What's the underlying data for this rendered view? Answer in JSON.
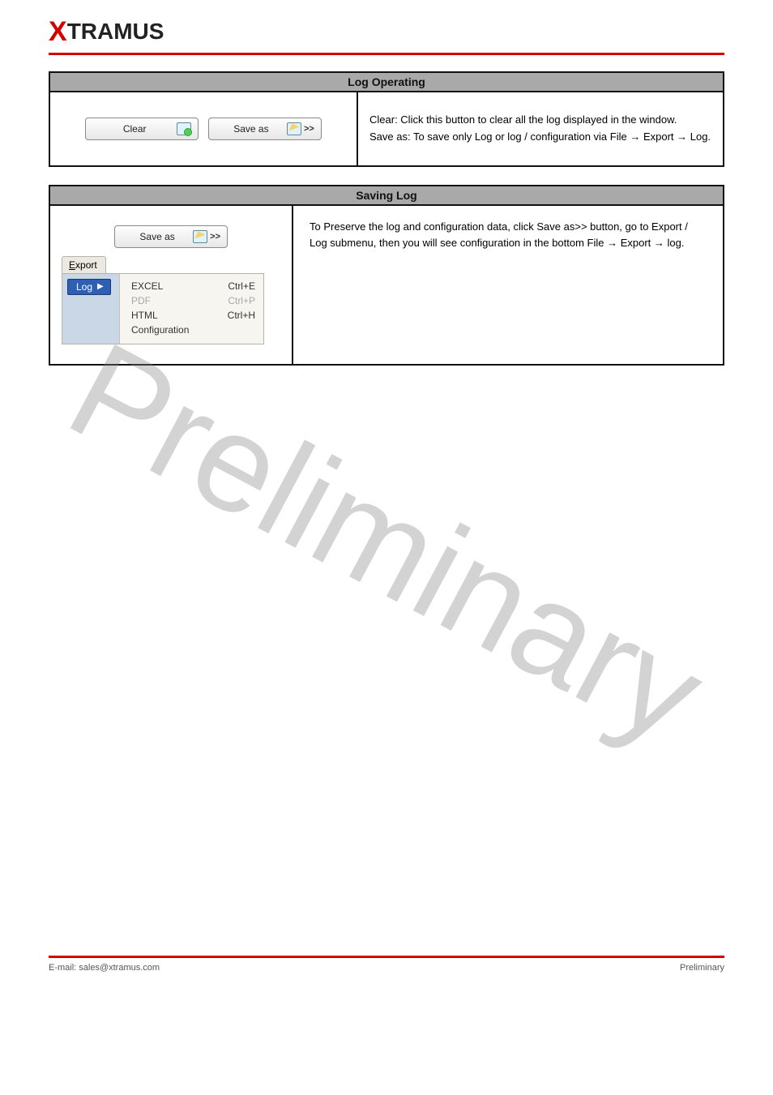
{
  "brand": {
    "x": "X",
    "rest": "TRAMUS"
  },
  "watermark": "Preliminary",
  "footer": {
    "left": "E-mail: sales@xtramus.com",
    "right": "Preliminary"
  },
  "table1": {
    "title": "Log Operating",
    "buttons": {
      "clear": "Clear",
      "saveas": "Save as",
      "chev": ">>"
    },
    "right_lines": [
      "Clear: Click this button to clear all the log displayed in the window.",
      "Save as: To save only Log or log / configuration via File → Export → Log."
    ]
  },
  "table2": {
    "title": "Saving Log",
    "button": {
      "saveas": "Save as",
      "chev": ">>"
    },
    "export_label_pre": "E",
    "export_label_post": "xport",
    "log_label": "Log",
    "items": [
      {
        "label": "EXCEL",
        "sc": "Ctrl+E",
        "disabled": false
      },
      {
        "label": "PDF",
        "sc": "Ctrl+P",
        "disabled": true
      },
      {
        "label": "HTML",
        "sc": "Ctrl+H",
        "disabled": false
      },
      {
        "label": "Configuration",
        "sc": "",
        "disabled": false
      }
    ],
    "right_lines": [
      "To Preserve the log and configuration data, click Save as>> button, go to Export / Log submenu, then you will see configuration in the bottom File → Export → log."
    ]
  }
}
